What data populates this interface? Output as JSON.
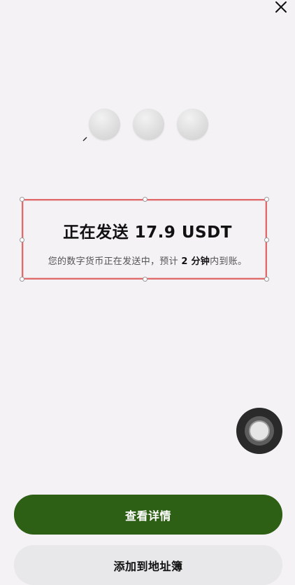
{
  "header": {
    "close_icon": "close-icon"
  },
  "status": {
    "title": "正在发送 17.9 USDT",
    "subtitle_before": "您的数字货币正在发送中，预计 ",
    "subtitle_bold": "2 分钟",
    "subtitle_after": "内到账。"
  },
  "actions": {
    "view_details_label": "查看详情",
    "add_to_address_book_label": "添加到地址簿"
  },
  "colors": {
    "primary_button": "#2d5f15",
    "secondary_button": "#e8e7ea",
    "selection_border": "#e06a6a",
    "background": "#f4f2f5"
  }
}
